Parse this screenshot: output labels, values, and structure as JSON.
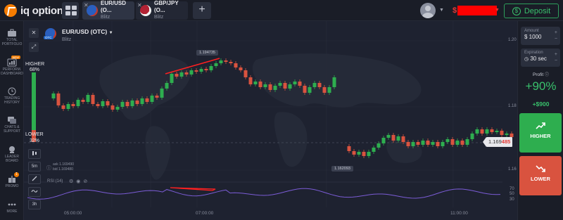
{
  "topbar": {
    "logo_text": "iq option",
    "tabs": [
      {
        "name": "EUR/USD (O...",
        "type": "Blitz",
        "flag": "eu"
      },
      {
        "name": "GBP/JPY (O...",
        "type": "Blitz",
        "flag": "gb"
      }
    ],
    "add_tab_label": "+",
    "balance_currency": "$",
    "deposit_label": "Deposit"
  },
  "sidebar": {
    "items": [
      {
        "label": "TOTAL PORTFOLIO",
        "icon": "briefcase-icon"
      },
      {
        "label": "PERFORM. DASHBOARD",
        "icon": "dashboard-icon",
        "badge": "NEW"
      },
      {
        "label": "TRADING HISTORY",
        "icon": "clock-icon"
      },
      {
        "label": "CHATS & SUPPORT",
        "icon": "chat-icon"
      },
      {
        "label": "LEADER BOARD",
        "icon": "trophy-icon"
      },
      {
        "label": "PROMO",
        "icon": "gift-icon",
        "badge": "1"
      },
      {
        "label": "MORE",
        "icon": "dots-icon"
      }
    ]
  },
  "chart": {
    "asset_title": "EUR/USD (OTC)",
    "asset_subtitle": "Blitz",
    "otc_badge": "OTC",
    "higher_label": "HIGHER",
    "higher_pct": "68%",
    "lower_label": "LOWER",
    "lower_pct": "32%",
    "ask": "ask 1.169490",
    "bid": "bid 1.169480",
    "timeframe": "5m",
    "candle_period": "3h",
    "rsi_label": "RSI (14)",
    "price_tag_main": "1.169",
    "price_tag_highlight": "485",
    "hover_labels": [
      "1.194735",
      "1.162093"
    ],
    "colors": {
      "up": "#2eae4f",
      "down": "#d9533f",
      "background": "#1e2230",
      "rsi_line": "#7b5cd6",
      "annotation": "#ff2020"
    }
  },
  "chart_data": {
    "type": "candlestick",
    "x_ticks": [
      "05:00:00",
      "07:00:00",
      "11:00:00"
    ],
    "y_ticks": [
      "1.20",
      "1.18",
      "1.16"
    ],
    "rsi_ticks": [
      "70",
      "50",
      "30"
    ]
  },
  "right_panel": {
    "amount_label": "Amount",
    "amount_value": "$ 1000",
    "expiration_label": "Expiration",
    "expiration_value": "30 sec",
    "profit_label": "Profit",
    "profit_pct": "+90%",
    "profit_amount": "+$900",
    "higher_button": "HIGHER",
    "lower_button": "LOWER"
  }
}
